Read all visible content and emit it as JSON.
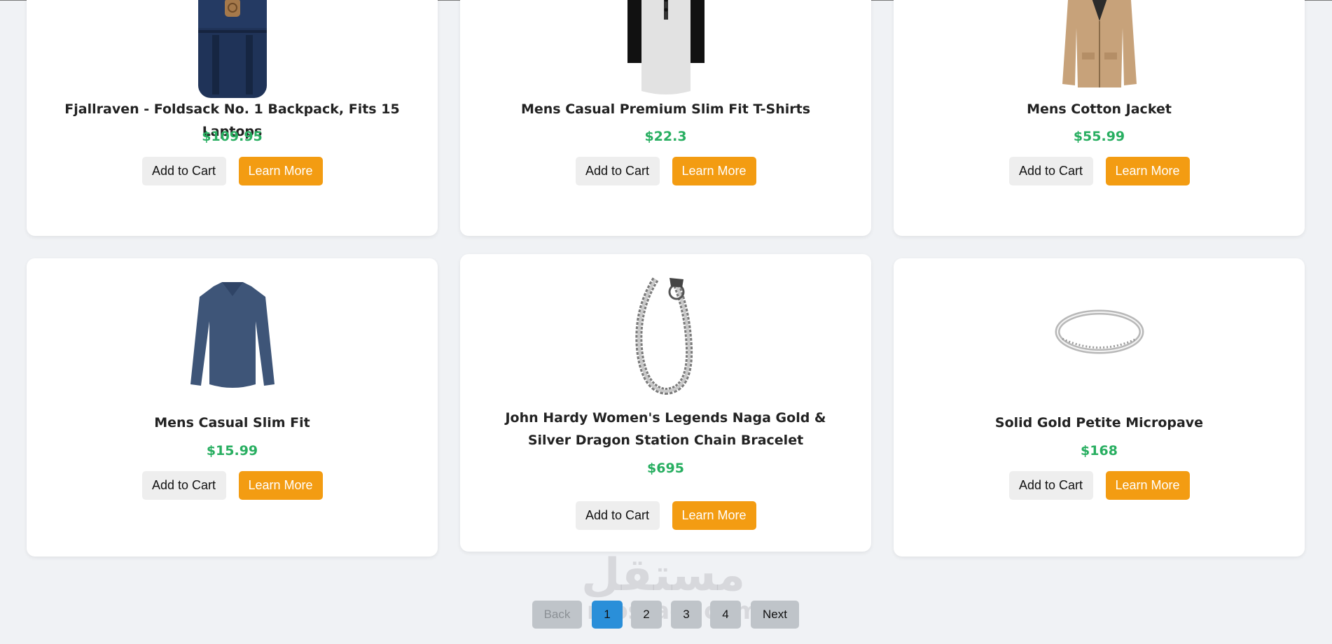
{
  "products": [
    {
      "title": "Fjallraven - Foldsack No. 1 Backpack, Fits 15 Laptops",
      "price": "$109.95",
      "image": "backpack-image"
    },
    {
      "title": "Mens Casual Premium Slim Fit T-Shirts",
      "price": "$22.3",
      "image": "raglan-tshirt-image"
    },
    {
      "title": "Mens Cotton Jacket",
      "price": "$55.99",
      "image": "cotton-jacket-image"
    },
    {
      "title": "Mens Casual Slim Fit",
      "price": "$15.99",
      "image": "long-sleeve-shirt-image"
    },
    {
      "title": "John Hardy Women's Legends Naga Gold & Silver Dragon Station Chain Bracelet",
      "price": "$695",
      "image": "dragon-bracelet-image"
    },
    {
      "title": "Solid Gold Petite Micropave",
      "price": "$168",
      "image": "micropave-ring-image"
    }
  ],
  "buttons": {
    "add_to_cart": "Add to Cart",
    "learn_more": "Learn More"
  },
  "pagination": {
    "back": "Back",
    "pages": [
      "1",
      "2",
      "3",
      "4"
    ],
    "active_page": "1",
    "next": "Next"
  },
  "watermark": {
    "arabic": "مستقل",
    "latin": "mostaql.com"
  },
  "colors": {
    "price": "#27ae60",
    "learn_more": "#f39c12",
    "active_page": "#2a8fd9",
    "background": "#f0f2f5"
  }
}
